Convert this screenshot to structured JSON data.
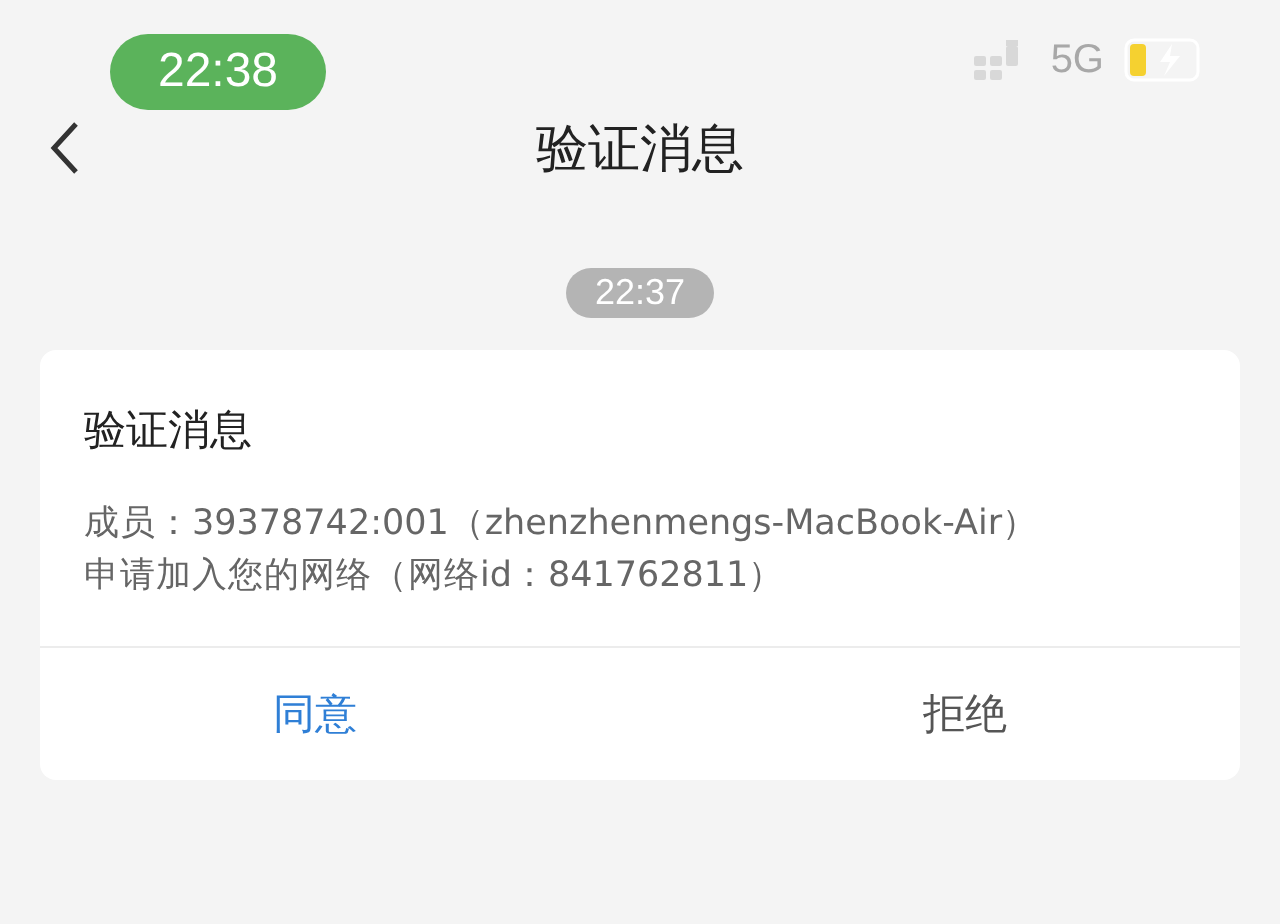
{
  "status_bar": {
    "time": "22:38",
    "network": "5G"
  },
  "header": {
    "title": "验证消息"
  },
  "timestamp": "22:37",
  "card": {
    "title": "验证消息",
    "lines": [
      "成员：39378742:001（zhenzhenmengs-MacBook-Air）",
      "申请加入您的网络（网络id：841762811）"
    ],
    "actions": [
      {
        "label": "同意",
        "kind": "primary"
      },
      {
        "label": "拒绝",
        "kind": "secondary"
      }
    ]
  }
}
